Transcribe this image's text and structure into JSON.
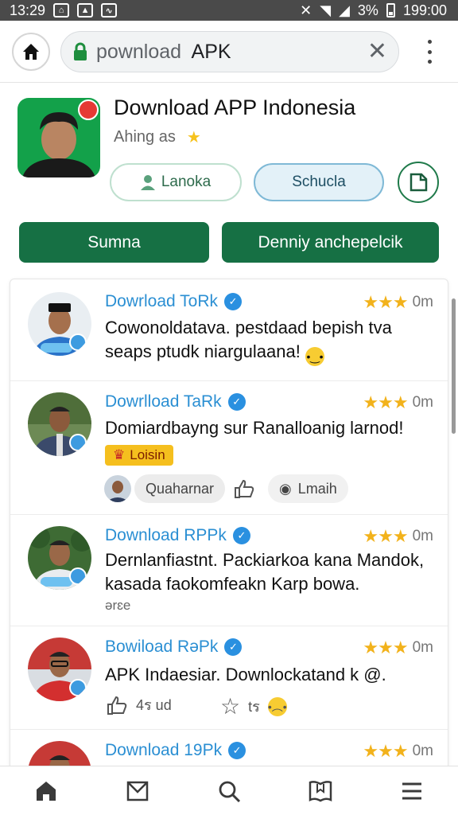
{
  "status_bar": {
    "time": "13:29",
    "battery": "3%",
    "clock": "199:00"
  },
  "browser": {
    "url_prefix": "pownload",
    "url_main": "APK",
    "close_glyph": "✕"
  },
  "app": {
    "title": "Download APP Indonesia",
    "subtitle": "Ahing as",
    "pill_a": "Lanoka",
    "pill_b": "Schucla",
    "button_1": "Sumna",
    "button_2": "Denniy anchepelcik"
  },
  "posts": [
    {
      "name": "Dowrload ToRk",
      "time": "0m",
      "text": "Cowonoldatava. pestdaad bepish tva seaps ptudk niargulaana!"
    },
    {
      "name": "Dowrlload TaRk",
      "time": "0m",
      "text": "Domiardbayng sur Ranalloanig larnod!",
      "label": "Loisin",
      "chip_1": "Quaharnar",
      "chip_2": "Lmaih"
    },
    {
      "name": "Download RPPk",
      "time": "0m",
      "text": "Dernlanfiastnt. Packiarkoa kana Mandok, kasada faokomfeakn Karp bowa.",
      "meta": "ərɛe"
    },
    {
      "name": "Bowiload RəPk",
      "time": "0m",
      "text": "APK Indaesiar. Downlockatand k @.",
      "likes": "4ร ud",
      "reacts": "tร"
    },
    {
      "name": "Download 19Pk",
      "time": "0m"
    }
  ],
  "colors": {
    "brand_green": "#167044",
    "link_blue": "#2b8fd3",
    "star": "#f2b21b"
  },
  "icons": [
    "home-icon",
    "lock-icon",
    "close-icon",
    "more-icon",
    "star-icon",
    "verified-icon",
    "mail-icon",
    "search-icon",
    "bookmark-icon",
    "menu-icon"
  ]
}
